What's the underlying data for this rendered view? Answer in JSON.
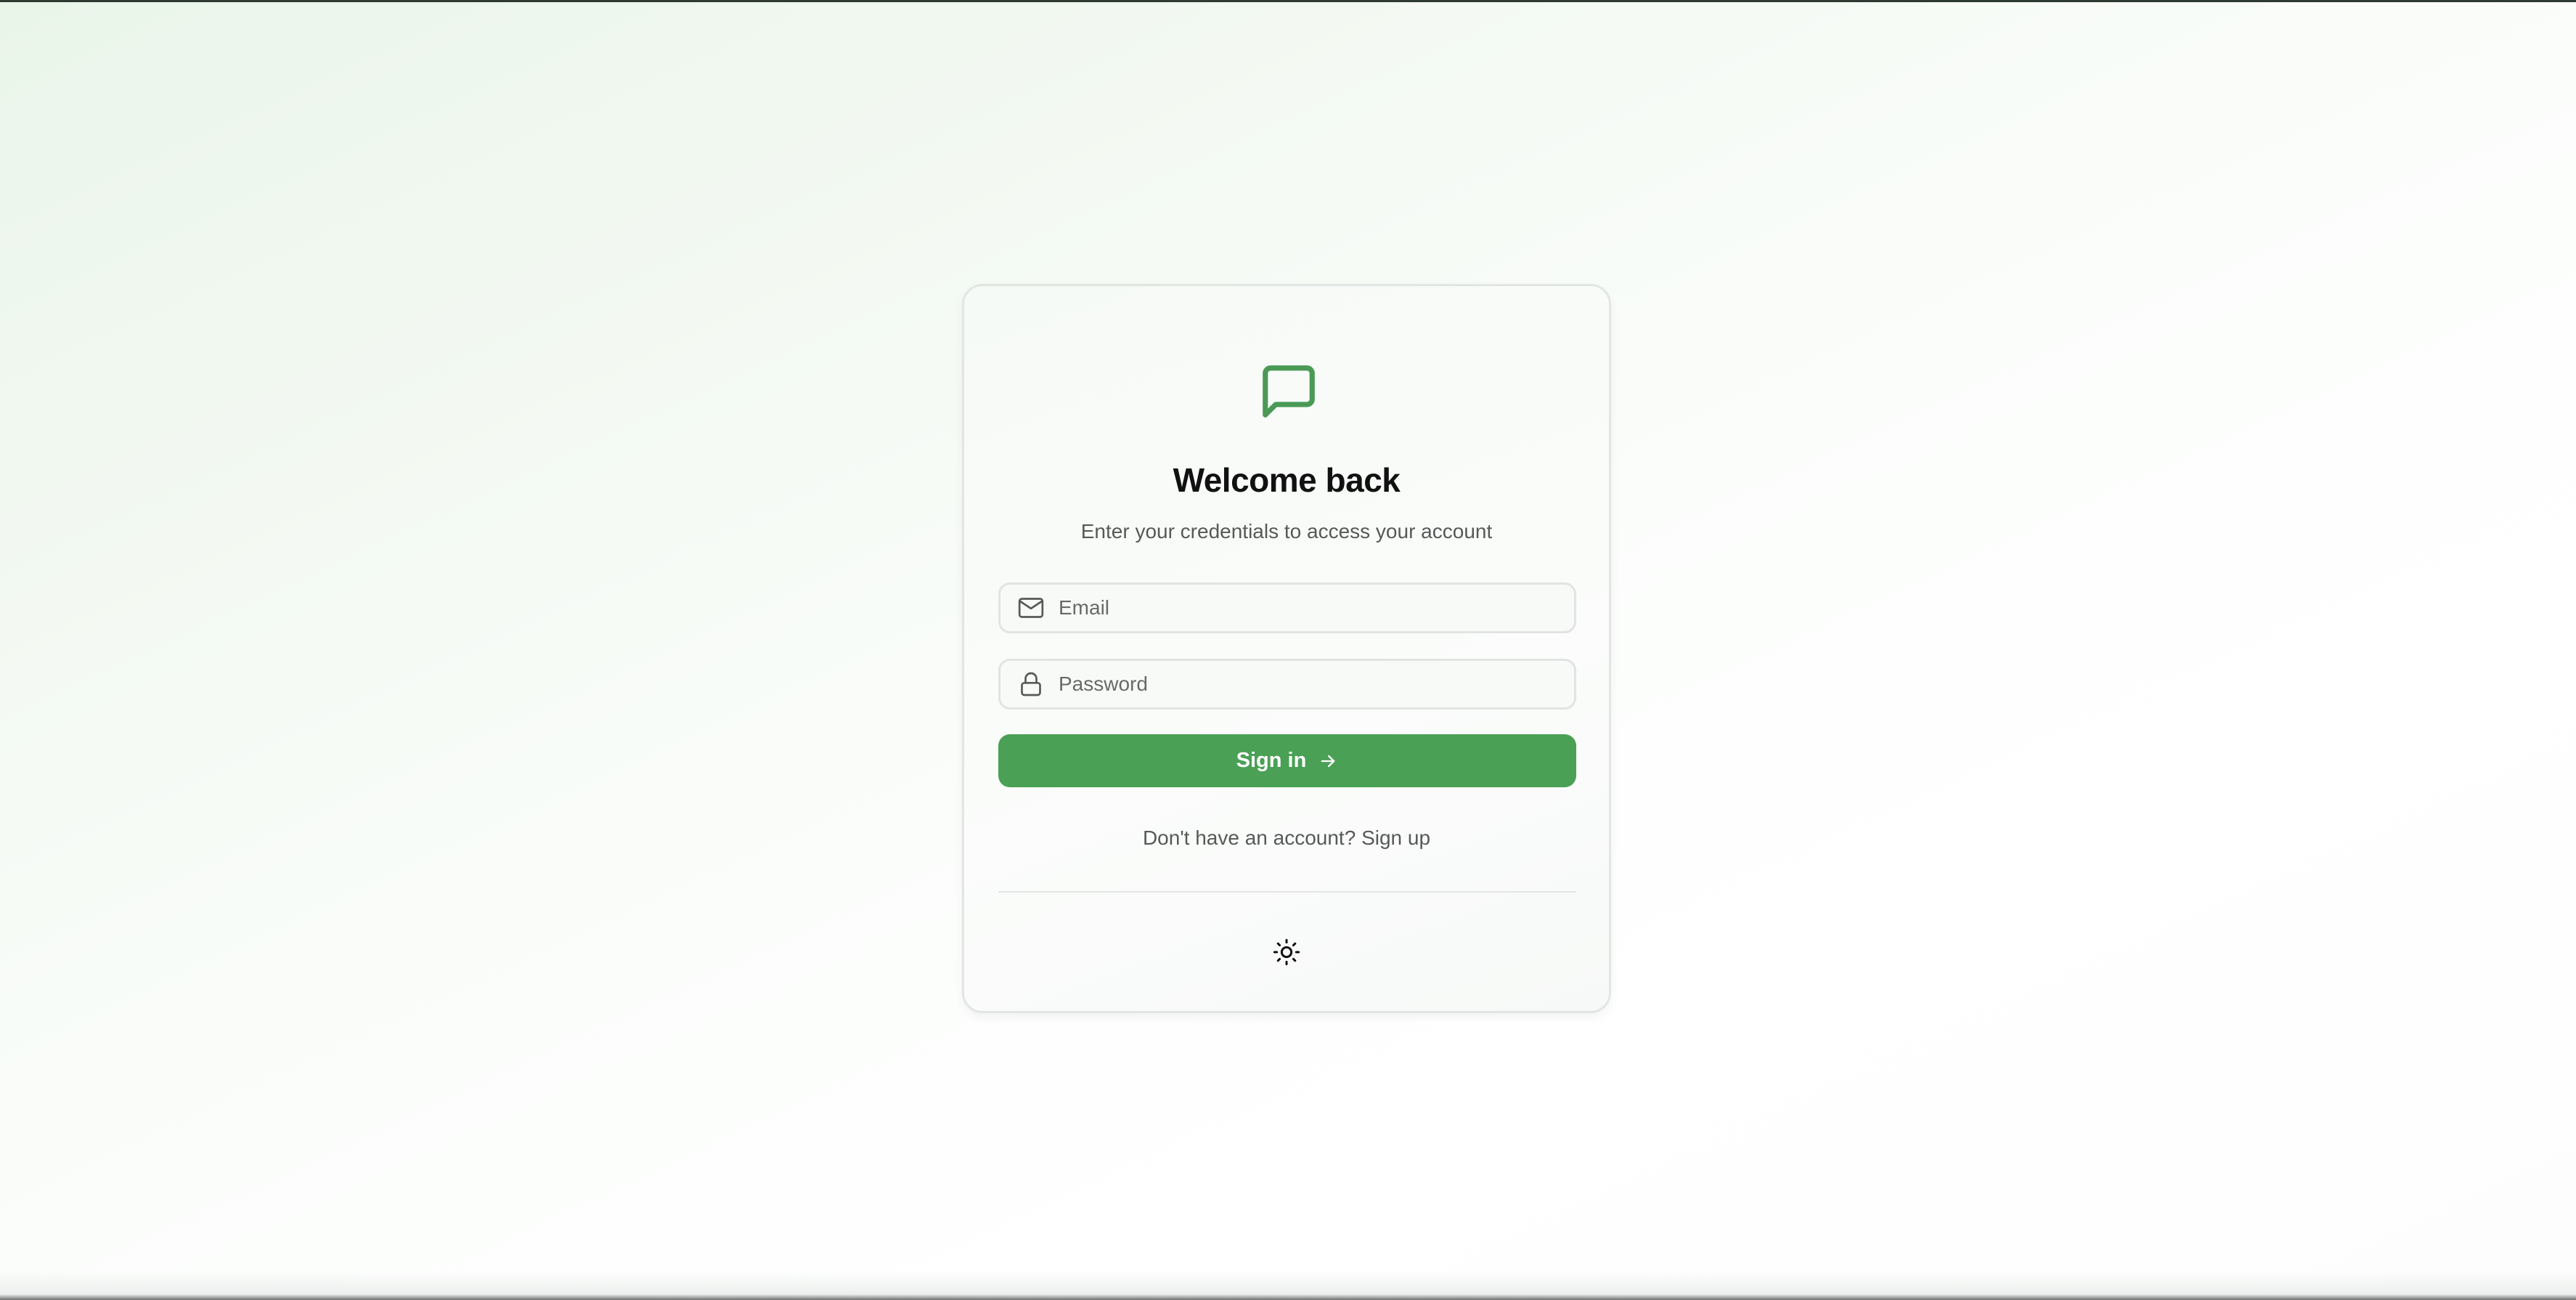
{
  "login": {
    "title": "Welcome back",
    "subtitle": "Enter your credentials to access your account",
    "email": {
      "placeholder": "Email",
      "value": ""
    },
    "password": {
      "placeholder": "Password",
      "value": ""
    },
    "signin_label": "Sign in",
    "no_account_text": "Don't have an account?",
    "signup_label": "Sign up"
  },
  "icons": {
    "logo": "message-square-icon",
    "email": "mail-icon",
    "password": "lock-icon",
    "signin": "arrow-right-icon",
    "theme": "sun-icon"
  },
  "colors": {
    "accent": "#4aa055",
    "logo": "#4a9a56",
    "text": "#111111",
    "muted": "#555a57"
  }
}
